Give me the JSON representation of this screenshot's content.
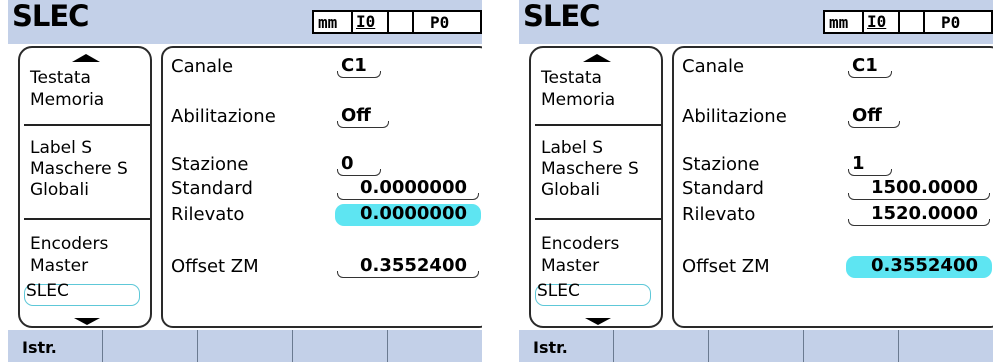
{
  "colors": {
    "titlebar": "#c3d0e8",
    "highlight": "#5ee5f2",
    "selection_outline": "#5ec8d8"
  },
  "screens": [
    {
      "title": "SLEC",
      "status": {
        "units": "mm",
        "io": "I0",
        "preset": "P0"
      },
      "menu": {
        "scroll_up_icon": "arrow-up",
        "scroll_down_icon": "arrow-down",
        "items": [
          "Testata",
          "Memoria",
          "Label S",
          "Maschere S",
          "Globali",
          "Encoders",
          "Master",
          "SLEC"
        ],
        "selected": "SLEC"
      },
      "fields": {
        "canale": {
          "label": "Canale",
          "value": "C1"
        },
        "abilitazione": {
          "label": "Abilitazione",
          "value": "Off"
        },
        "stazione": {
          "label": "Stazione",
          "value": "0"
        },
        "standard": {
          "label": "Standard",
          "value": "0.0000000"
        },
        "rilevato": {
          "label": "Rilevato",
          "value": "0.0000000"
        },
        "offset": {
          "label": "Offset ZM",
          "value": "0.3552400"
        }
      },
      "highlighted_field": "rilevato",
      "softkeys": [
        "Istr.",
        "",
        "",
        "",
        ""
      ]
    },
    {
      "title": "SLEC",
      "status": {
        "units": "mm",
        "io": "I0",
        "preset": "P0"
      },
      "menu": {
        "scroll_up_icon": "arrow-up",
        "scroll_down_icon": "arrow-down",
        "items": [
          "Testata",
          "Memoria",
          "Label S",
          "Maschere S",
          "Globali",
          "Encoders",
          "Master",
          "SLEC"
        ],
        "selected": "SLEC"
      },
      "fields": {
        "canale": {
          "label": "Canale",
          "value": "C1"
        },
        "abilitazione": {
          "label": "Abilitazione",
          "value": "Off"
        },
        "stazione": {
          "label": "Stazione",
          "value": "1"
        },
        "standard": {
          "label": "Standard",
          "value": "1500.0000"
        },
        "rilevato": {
          "label": "Rilevato",
          "value": "1520.0000"
        },
        "offset": {
          "label": "Offset ZM",
          "value": "0.3552400"
        }
      },
      "highlighted_field": "offset",
      "softkeys": [
        "Istr.",
        "",
        "",
        "",
        ""
      ]
    }
  ]
}
